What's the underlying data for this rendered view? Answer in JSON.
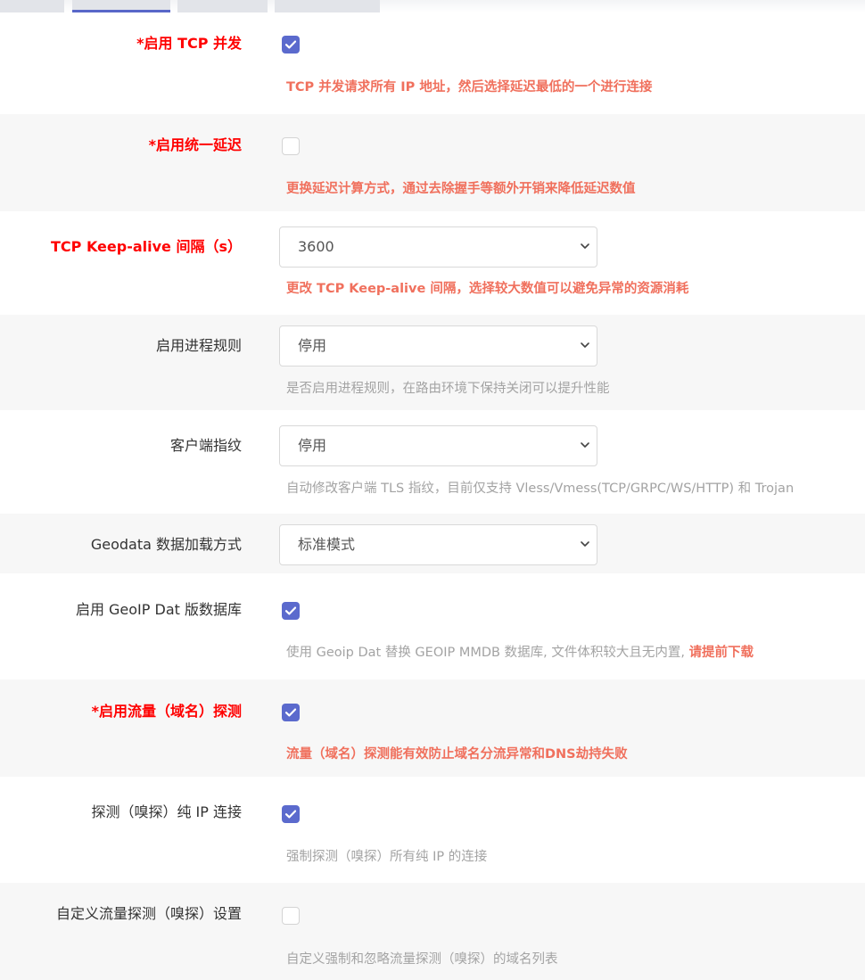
{
  "colors": {
    "accent": "#5b6acd",
    "required": "#ff0000",
    "warning": "#f0705d",
    "muted": "#a3a3a3"
  },
  "rows": [
    {
      "label": "*启用 TCP 并发",
      "control": "checkbox",
      "checked": true,
      "desc": "TCP 并发请求所有 IP 地址，然后选择延迟最低的一个进行连接"
    },
    {
      "label": "*启用统一延迟",
      "control": "checkbox",
      "checked": false,
      "desc": "更换延迟计算方式，通过去除握手等额外开销来降低延迟数值"
    },
    {
      "label": "TCP Keep-alive 间隔（s）",
      "control": "select",
      "value": "3600",
      "desc": "更改 TCP Keep-alive 间隔，选择较大数值可以避免异常的资源消耗"
    },
    {
      "label": "启用进程规则",
      "control": "select",
      "value": "停用",
      "desc": "是否启用进程规则，在路由环境下保持关闭可以提升性能"
    },
    {
      "label": "客户端指纹",
      "control": "select",
      "value": "停用",
      "desc": "自动修改客户端 TLS 指纹，目前仅支持 Vless/Vmess(TCP/GRPC/WS/HTTP) 和 Trojan"
    },
    {
      "label": "Geodata 数据加载方式",
      "control": "select",
      "value": "标准模式"
    },
    {
      "label": "启用 GeoIP Dat 版数据库",
      "control": "checkbox",
      "checked": true,
      "desc": "使用 Geoip Dat 替换 GEOIP MMDB 数据库, 文件体积较大且无内置, ",
      "desc_emphasis": "请提前下载"
    },
    {
      "label": "*启用流量（域名）探测",
      "control": "checkbox",
      "checked": true,
      "desc": "流量（域名）探测能有效防止域名分流异常和DNS劫持失败"
    },
    {
      "label": "探测（嗅探）纯 IP 连接",
      "control": "checkbox",
      "checked": true,
      "desc": "强制探测（嗅探）所有纯 IP 的连接"
    },
    {
      "label": "自定义流量探测（嗅探）设置",
      "control": "checkbox",
      "checked": false,
      "desc": "自定义强制和忽略流量探测（嗅探）的域名列表"
    }
  ]
}
